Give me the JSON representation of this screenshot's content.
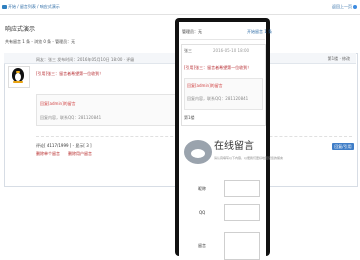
{
  "breadcrumb": {
    "text": "开始 / 留言列表 / 响应式演示",
    "back_label": "返回上一页"
  },
  "page": {
    "title": "响应式演示",
    "stats": "共有留言 1 条 - 浏览 0 条 - 管理员：无"
  },
  "post": {
    "meta": "网友：张三  发布时间：2016年05月10日 18:00 · 评级",
    "floor": "第1楼 · 修改",
    "quote_line": "[引用]张三：留言者希望第一位收到！",
    "quote_title": "回复[admin]的留言",
    "quote_body": "回复内容，联系QQ：281120841",
    "count": "评论[ 4117/1999 ] - 显示[ 3 ]",
    "delete_one": "删除单个留言",
    "delete_all": "删除用户留言",
    "reply_label": "回复/引用"
  },
  "mobile": {
    "stats": "管理员：无",
    "back": "开始留言 1 条",
    "user": "张三",
    "time": "2016-05-10 18:00",
    "floor": "第1楼",
    "online_title": "在线留言",
    "online_sub": "请认真填写以下内容，以便我们更好地回复您的留言",
    "name_label": "昵称",
    "qq_label": "QQ",
    "msg_label": "留言"
  },
  "colors": {
    "accent": "#2b6aa5",
    "danger": "#b32020",
    "button": "#3f7dc7",
    "phone": "#111111"
  }
}
